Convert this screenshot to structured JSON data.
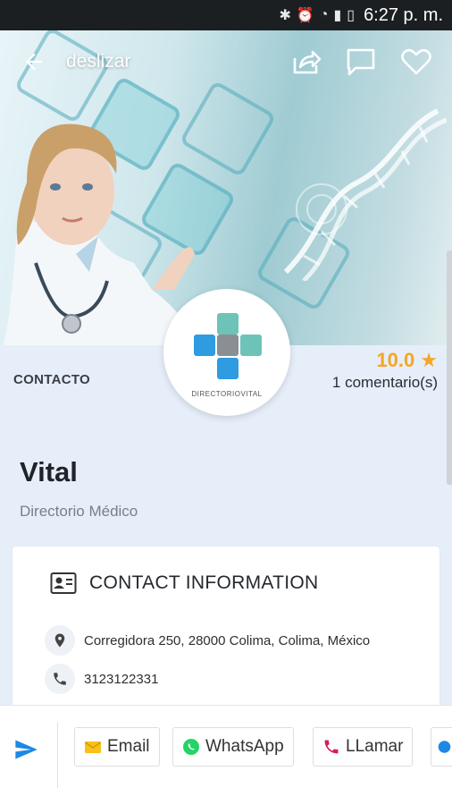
{
  "status_bar": {
    "time": "6:27 p. m.",
    "icons": [
      "bluetooth-icon",
      "alarm-icon",
      "wifi-icon",
      "signal-icon",
      "battery-icon"
    ]
  },
  "top_bar": {
    "title": "deslizar",
    "icons": [
      "back-arrow-icon",
      "share-icon",
      "comment-icon",
      "heart-icon"
    ]
  },
  "profile": {
    "section_label": "CONTACTO",
    "rating_score": "10.0",
    "rating_star": "★",
    "comments": "1 comentario(s)",
    "logo_text": "DIRECTORIOVITAL",
    "name": "Vital",
    "category": "Directorio Médico"
  },
  "contact_card": {
    "title": "CONTACT INFORMATION",
    "address": "Corregidora 250, 28000 Colima, Colima, México",
    "phone": "3123122331"
  },
  "bottom_bar": {
    "buttons": [
      {
        "label": "Email",
        "icon": "email-icon"
      },
      {
        "label": "WhatsApp",
        "icon": "whatsapp-icon"
      },
      {
        "label": "LLamar",
        "icon": "phone-icon"
      }
    ]
  },
  "colors": {
    "accent_orange": "#f5a623",
    "band_bg": "#e6eefa",
    "status_bg": "#1c1f22",
    "send_blue": "#1e88e5",
    "whatsapp_green": "#25d366",
    "call_red": "#d81b60"
  }
}
